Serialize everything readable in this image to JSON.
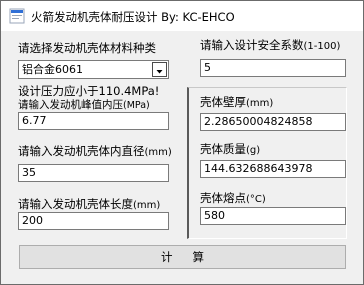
{
  "window": {
    "title": "火箭发动机壳体耐压设计 By:  KC-EHCO"
  },
  "left": {
    "material_label": "请选择发动机壳体材料种类",
    "material_selected": "铝合金6061",
    "pressure_warning": "设计压力应小于110.4MPa!",
    "pressure_label": "请输入发动机峰值内压",
    "pressure_unit": "(MPa)",
    "pressure_value": "6.77",
    "diameter_label": "请输入发动机壳体内直径",
    "diameter_unit": "(mm)",
    "diameter_value": "35",
    "length_label": "请输入发动机壳体长度",
    "length_unit": "(mm)",
    "length_value": "200"
  },
  "right": {
    "safety_label": "请输入设计安全系数",
    "safety_range": "(1-100)",
    "safety_value": "5",
    "thickness_label": "壳体壁厚",
    "thickness_unit": "(mm)",
    "thickness_value": "2.28650004824858",
    "mass_label": "壳体质量",
    "mass_unit": "(g)",
    "mass_value": "144.632688643978",
    "melting_label": "壳体熔点",
    "melting_unit": "(°C)",
    "melting_value": "580"
  },
  "actions": {
    "calculate_label": "计算"
  },
  "icons": {
    "app": "rocket-app-icon",
    "dropdown": "chevron-down-icon"
  },
  "colors": {
    "window_bg": "#f0f0f0",
    "titlebar_bg": "#ffffff",
    "field_border": "#7a7a7a",
    "button_bg": "#e1e1e1"
  }
}
